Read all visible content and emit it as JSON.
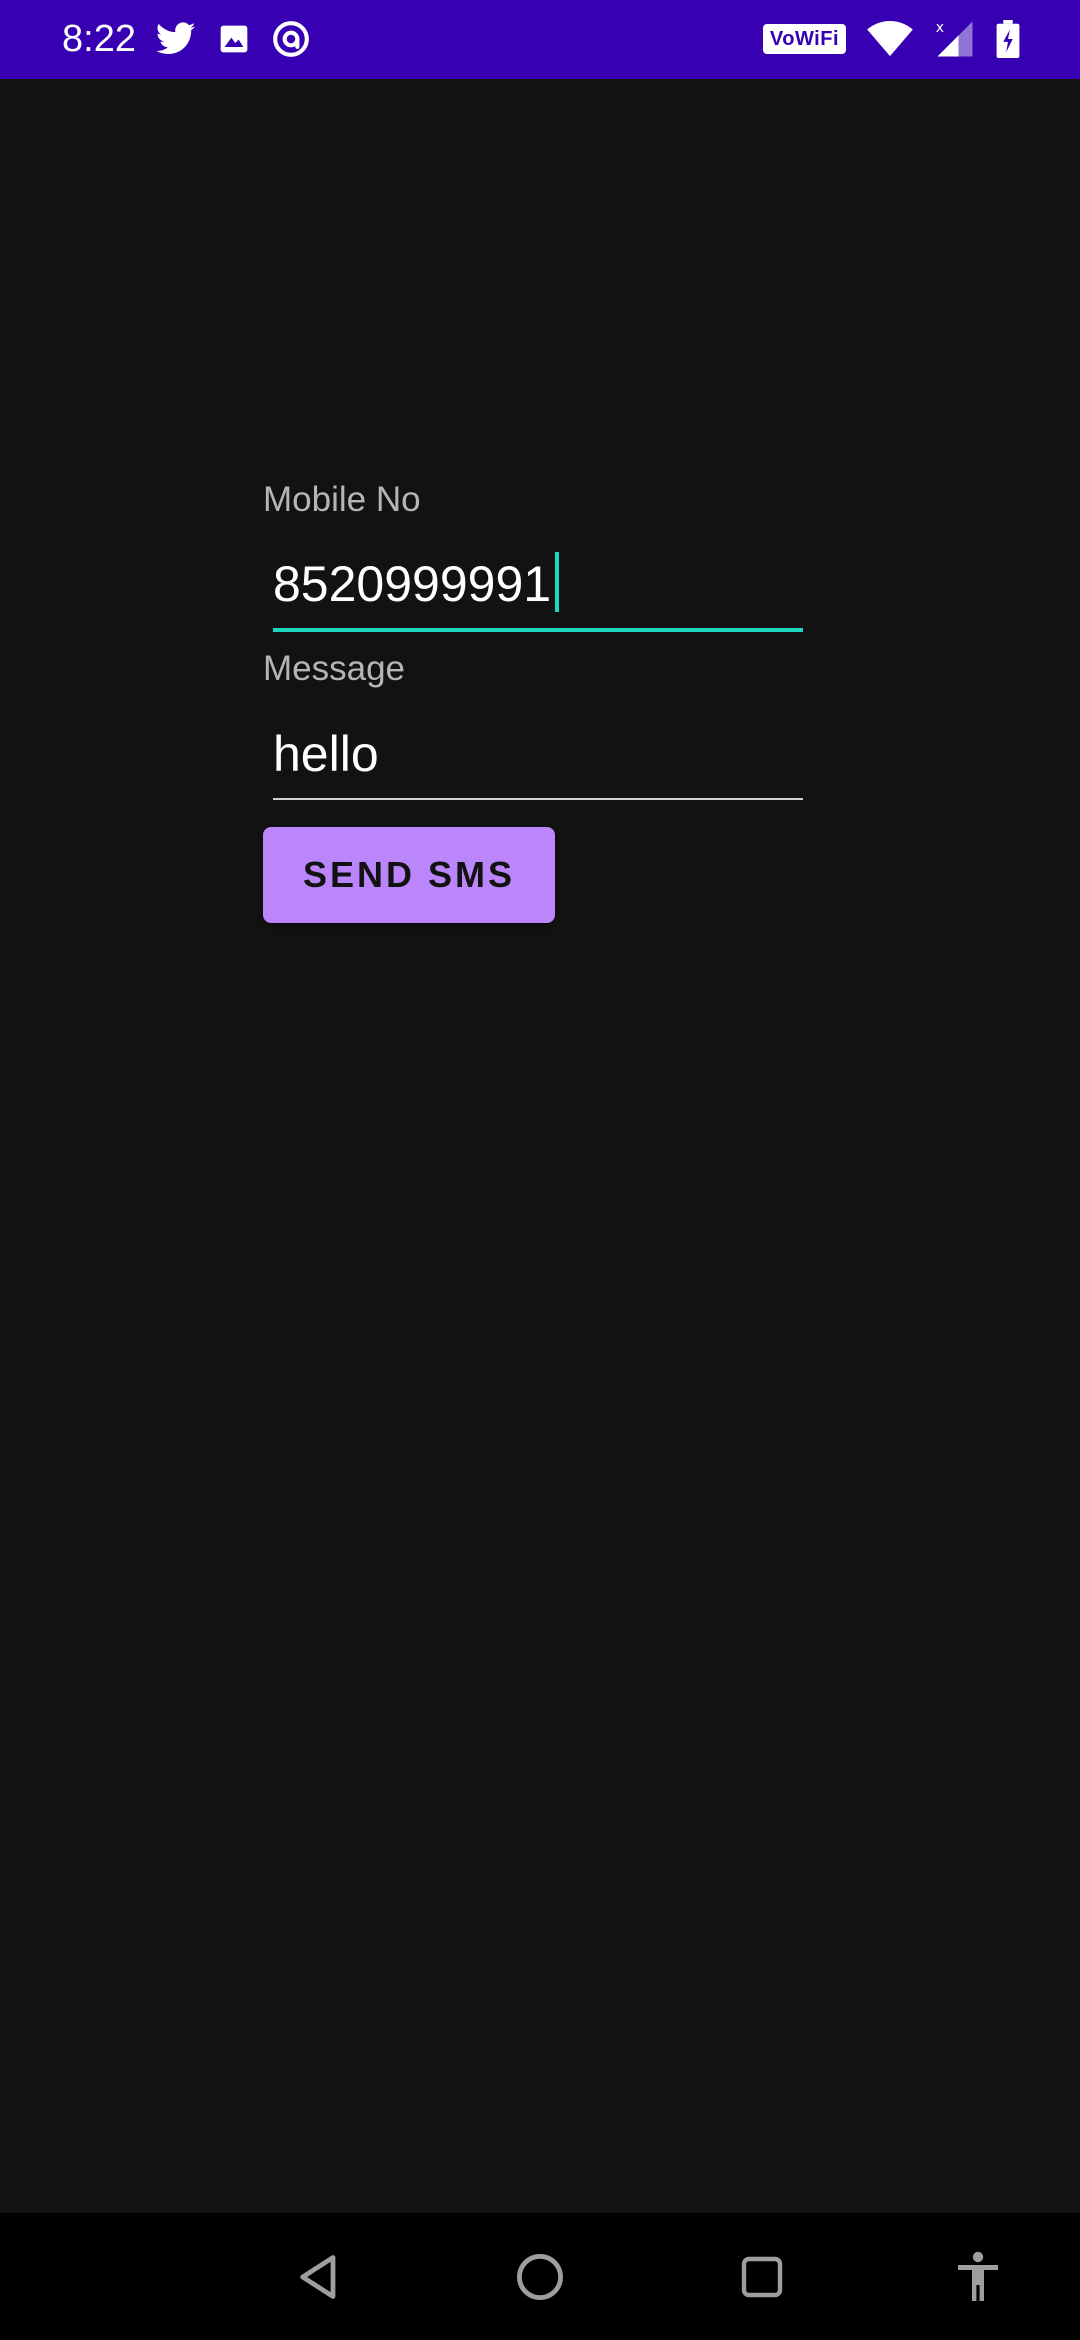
{
  "status_bar": {
    "time": "8:22",
    "left_icons": [
      "twitter-icon",
      "image-icon",
      "at-sign-icon"
    ],
    "network_badge": "VoWiFi",
    "right_icons": [
      "wifi-icon",
      "mobile-signal-icon",
      "battery-charging-icon"
    ],
    "background_color": "#3700b3"
  },
  "form": {
    "mobile_label": "Mobile No",
    "mobile_value": "8520999991",
    "message_label": "Message",
    "message_value": "hello",
    "send_button_label": "SEND SMS"
  },
  "colors": {
    "accent_purple": "#bb86fc",
    "focus_teal": "#1ed6c0",
    "background": "#121212"
  },
  "nav_bar": {
    "icons": [
      "back-icon",
      "home-icon",
      "recents-icon",
      "accessibility-icon"
    ]
  }
}
